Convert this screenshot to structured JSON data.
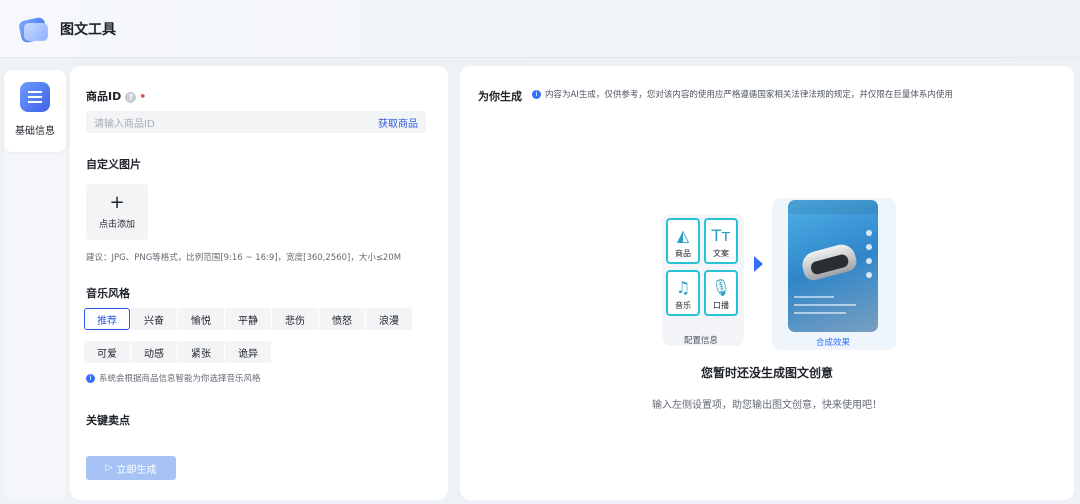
{
  "header": {
    "title": "图文工具"
  },
  "sidebar": {
    "items": [
      {
        "label": "基础信息"
      }
    ]
  },
  "form": {
    "product_id": {
      "label": "商品ID",
      "placeholder": "请输入商品ID",
      "action": "获取商品"
    },
    "image": {
      "label": "自定义图片",
      "upload_label": "点击添加",
      "hint": "建议：JPG、PNG等格式，比例范围[9:16 ~ 16:9]，宽度[360,2560]，大小≤20M"
    },
    "music": {
      "label": "音乐风格",
      "styles_row1": [
        "推荐",
        "兴奋",
        "愉悦",
        "平静",
        "悲伤",
        "愤怒",
        "浪漫"
      ],
      "styles_row2": [
        "可爱",
        "动感",
        "紧张",
        "诡异"
      ],
      "selected": "推荐",
      "hint": "系统会根据商品信息智能为你选择音乐风格"
    },
    "selling_points": {
      "label": "关键卖点"
    },
    "generate_button": "立即生成"
  },
  "result": {
    "title": "为你生成",
    "notice": "内容为AI生成，仅供参考，您对该内容的使用应严格遵循国家相关法律法规的规定，并仅限在巨量体系内使用",
    "illustration": {
      "tiles": [
        "商品",
        "文案",
        "音乐",
        "口播"
      ],
      "left_caption": "配置信息",
      "right_caption": "合成效果"
    },
    "empty_title": "您暂时还没生成图文创意",
    "empty_subtitle": "输入左侧设置项，助您输出图文创意，快来使用吧！"
  },
  "colors": {
    "accent": "#2f5be0",
    "button_disabled": "#a7c2f5"
  }
}
